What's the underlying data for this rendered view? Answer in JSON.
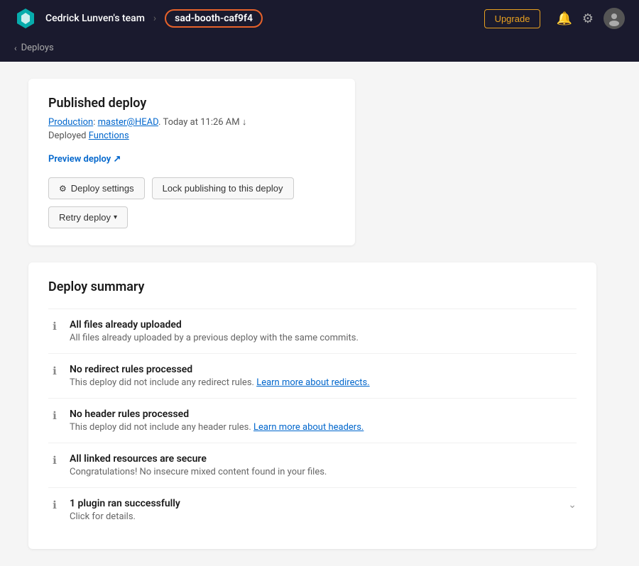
{
  "header": {
    "team_name": "Cedrick Lunven's team",
    "site_name": "sad-booth-caf9f4",
    "upgrade_label": "Upgrade"
  },
  "breadcrumb": {
    "back_label": "Deploys"
  },
  "deploy_card": {
    "title": "Published deploy",
    "meta_branch": "Production",
    "meta_ref": "master@HEAD",
    "meta_time": "Today at 11:26 AM",
    "meta_arrow": "↓",
    "functions_label": "Deployed",
    "functions_link": "Functions",
    "preview_link": "Preview deploy ↗",
    "btn_settings": "Deploy settings",
    "btn_lock": "Lock publishing to this deploy",
    "btn_retry": "Retry deploy"
  },
  "summary": {
    "title": "Deploy summary",
    "items": [
      {
        "title": "All files already uploaded",
        "desc": "All files already uploaded by a previous deploy with the same commits.",
        "has_link": false
      },
      {
        "title": "No redirect rules processed",
        "desc": "This deploy did not include any redirect rules.",
        "link_text": "Learn more about redirects.",
        "has_link": true
      },
      {
        "title": "No header rules processed",
        "desc": "This deploy did not include any header rules.",
        "link_text": "Learn more about headers.",
        "has_link": true
      },
      {
        "title": "All linked resources are secure",
        "desc": "Congratulations! No insecure mixed content found in your files.",
        "has_link": false
      }
    ],
    "last_item": {
      "title": "1 plugin ran successfully",
      "desc": "Click for details."
    }
  }
}
